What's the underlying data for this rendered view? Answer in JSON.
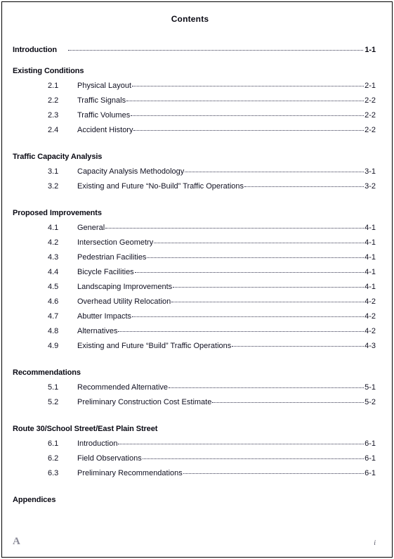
{
  "document": {
    "title": "Contents"
  },
  "toc": {
    "chapters": [
      {
        "title": "Introduction",
        "page": "1-1",
        "has_leader": true,
        "sections": []
      },
      {
        "title": "Existing Conditions",
        "page": "",
        "has_leader": false,
        "sections": [
          {
            "num": "2.1",
            "title": "Physical Layout",
            "page": "2-1"
          },
          {
            "num": "2.2",
            "title": "Traffic Signals",
            "page": "2-2"
          },
          {
            "num": "2.3",
            "title": "Traffic Volumes",
            "page": "2-2"
          },
          {
            "num": "2.4",
            "title": "Accident History",
            "page": "2-2"
          }
        ]
      },
      {
        "title": "Traffic Capacity Analysis",
        "page": "",
        "has_leader": false,
        "sections": [
          {
            "num": "3.1",
            "title": "Capacity Analysis Methodology",
            "page": "3-1"
          },
          {
            "num": "3.2",
            "title": "Existing and Future “No-Build” Traffic Operations",
            "page": "3-2"
          }
        ]
      },
      {
        "title": "Proposed Improvements",
        "page": "",
        "has_leader": false,
        "sections": [
          {
            "num": "4.1",
            "title": "General",
            "page": "4-1"
          },
          {
            "num": "4.2",
            "title": "Intersection Geometry",
            "page": "4-1"
          },
          {
            "num": "4.3",
            "title": "Pedestrian Facilities",
            "page": "4-1"
          },
          {
            "num": "4.4",
            "title": "Bicycle Facilities",
            "page": "4-1"
          },
          {
            "num": "4.5",
            "title": "Landscaping Improvements",
            "page": "4-1"
          },
          {
            "num": "4.6",
            "title": "Overhead Utility Relocation",
            "page": "4-2"
          },
          {
            "num": "4.7",
            "title": "Abutter Impacts",
            "page": "4-2"
          },
          {
            "num": "4.8",
            "title": "Alternatives",
            "page": "4-2"
          },
          {
            "num": "4.9",
            "title": "Existing and Future “Build” Traffic Operations",
            "page": "4-3"
          }
        ]
      },
      {
        "title": "Recommendations",
        "page": "",
        "has_leader": false,
        "sections": [
          {
            "num": "5.1",
            "title": "Recommended Alternative",
            "page": "5-1"
          },
          {
            "num": "5.2",
            "title": "Preliminary Construction Cost Estimate",
            "page": "5-2"
          }
        ]
      },
      {
        "title": "Route 30/School Street/East Plain Street",
        "page": "",
        "has_leader": false,
        "sections": [
          {
            "num": "6.1",
            "title": "Introduction",
            "page": "6-1"
          },
          {
            "num": "6.2",
            "title": "Field Observations",
            "page": "6-1"
          },
          {
            "num": "6.3",
            "title": "Preliminary Recommendations",
            "page": "6-1"
          }
        ]
      },
      {
        "title": "Appendices",
        "page": "",
        "has_leader": false,
        "sections": []
      }
    ]
  },
  "footer": {
    "mark": "A",
    "page_number": "i"
  }
}
